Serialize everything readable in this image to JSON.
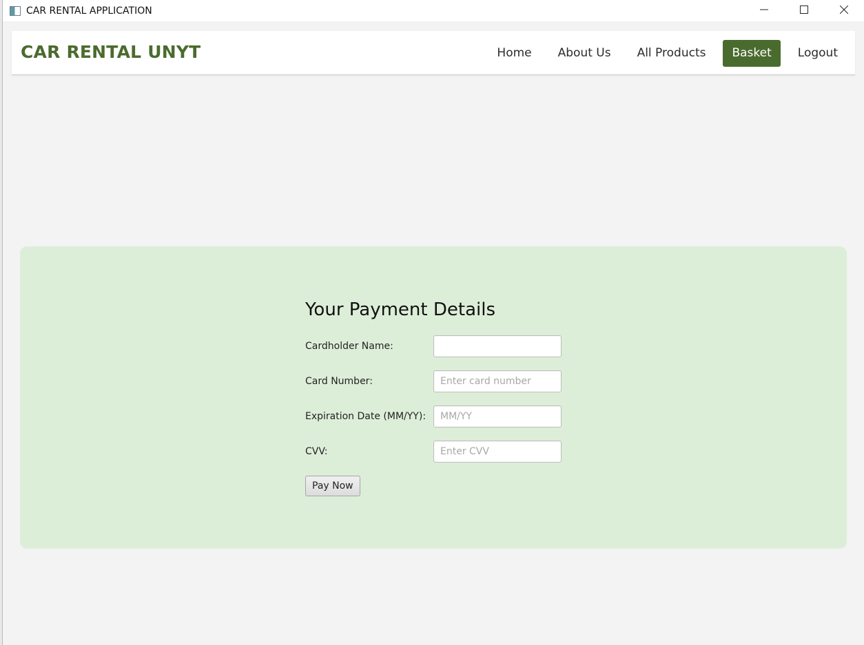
{
  "window": {
    "title": "CAR RENTAL APPLICATION",
    "controls": [
      "minimize",
      "maximize",
      "close"
    ]
  },
  "navbar": {
    "brand": "CAR RENTAL UNYT",
    "links": [
      {
        "label": "Home",
        "active": false
      },
      {
        "label": "About Us",
        "active": false
      },
      {
        "label": "All Products",
        "active": false
      },
      {
        "label": "Basket",
        "active": true
      },
      {
        "label": "Logout",
        "active": false
      }
    ]
  },
  "payment": {
    "title": "Your Payment Details",
    "fields": [
      {
        "label": "Cardholder Name:",
        "value": "",
        "placeholder": ""
      },
      {
        "label": "Card Number:",
        "value": "",
        "placeholder": "Enter card number"
      },
      {
        "label": "Expiration Date (MM/YY):",
        "value": "",
        "placeholder": "MM/YY"
      },
      {
        "label": "CVV:",
        "value": "",
        "placeholder": "Enter CVV"
      }
    ],
    "submit_label": "Pay Now"
  },
  "colors": {
    "brand_green": "#4a6b2e",
    "panel_bg": "#ddeed8",
    "window_bg": "#f3f3f3"
  }
}
